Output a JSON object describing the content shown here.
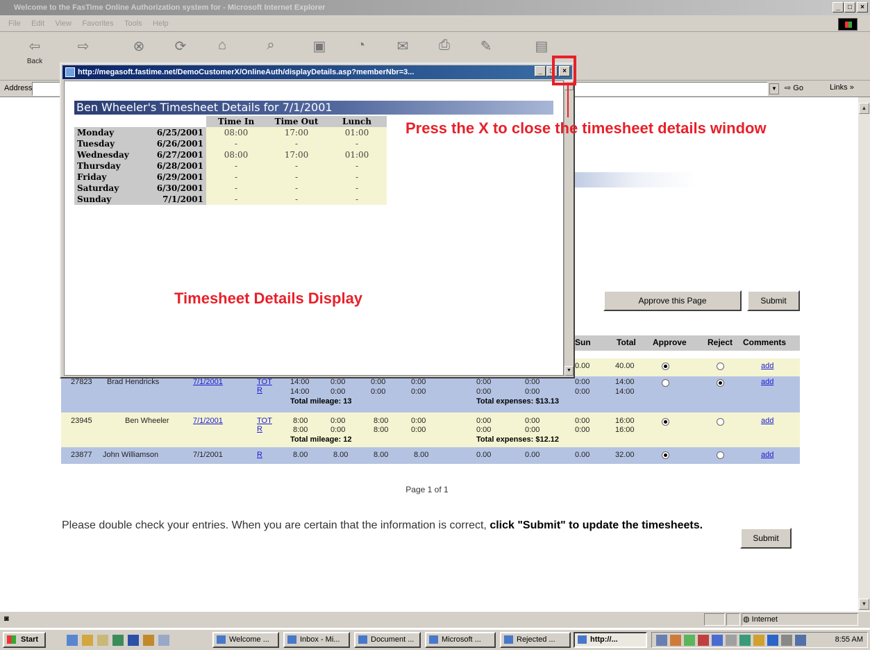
{
  "browser": {
    "title": "Welcome to the FasTime Online Authorization system for - Microsoft Internet Explorer",
    "menu": [
      "File",
      "Edit",
      "View",
      "Favorites",
      "Tools",
      "Help"
    ],
    "back_label": "Back",
    "address_label": "Address",
    "go_label": "Go",
    "links_label": "Links",
    "window_buttons": {
      "minimize": "_",
      "maximize": "□",
      "close": "×"
    }
  },
  "popup": {
    "title": "http://megasoft.fastime.net/DemoCustomerX/OnlineAuth/displayDetails.asp?memberNbr=3...",
    "close": "×",
    "header": "Ben Wheeler's Timesheet Details for 7/1/2001",
    "columns": [
      "Time In",
      "Time Out",
      "Lunch"
    ],
    "rows": [
      {
        "day": "Monday",
        "date": "6/25/2001",
        "in": "08:00",
        "out": "17:00",
        "lunch": "01:00"
      },
      {
        "day": "Tuesday",
        "date": "6/26/2001",
        "in": "-",
        "out": "-",
        "lunch": "-"
      },
      {
        "day": "Wednesday",
        "date": "6/27/2001",
        "in": "08:00",
        "out": "17:00",
        "lunch": "01:00"
      },
      {
        "day": "Thursday",
        "date": "6/28/2001",
        "in": "-",
        "out": "-",
        "lunch": "-"
      },
      {
        "day": "Friday",
        "date": "6/29/2001",
        "in": "-",
        "out": "-",
        "lunch": "-"
      },
      {
        "day": "Saturday",
        "date": "6/30/2001",
        "in": "-",
        "out": "-",
        "lunch": "-"
      },
      {
        "day": "Sunday",
        "date": "7/1/2001",
        "in": "-",
        "out": "-",
        "lunch": "-"
      }
    ]
  },
  "annotations": {
    "close_hint": "Press the X to close the timesheet details window",
    "details_label": "Timesheet Details Display",
    "color": "#e8202a"
  },
  "page": {
    "approve_button": "Approve this Page",
    "submit_button": "Submit",
    "grid_headers": [
      "Sun",
      "Total",
      "Approve",
      "Reject",
      "Comments"
    ],
    "row1": {
      "sun": "0.00",
      "total": "40.00",
      "comment": "add"
    },
    "row2": {
      "id": "27823",
      "name": "Brad Hendricks",
      "date": "7/1/2001",
      "t": "TOT",
      "r": "R",
      "line1": [
        "14:00",
        "0:00",
        "0:00",
        "0:00",
        "0:00",
        "0:00",
        "0:00",
        "14:00"
      ],
      "line2": [
        "14:00",
        "0:00",
        "0:00",
        "0:00",
        "0:00",
        "0:00",
        "0:00",
        "14:00"
      ],
      "mileage": "Total mileage: 13",
      "expenses": "Total expenses: $13.13",
      "comment": "add"
    },
    "row3": {
      "id": "23945",
      "name": "Ben Wheeler",
      "date": "7/1/2001",
      "t": "TOT",
      "r": "R",
      "line1": [
        "8:00",
        "0:00",
        "8:00",
        "0:00",
        "0:00",
        "0:00",
        "0:00",
        "16:00"
      ],
      "line2": [
        "8:00",
        "0:00",
        "8:00",
        "0:00",
        "0:00",
        "0:00",
        "0:00",
        "16:00"
      ],
      "mileage": "Total mileage: 12",
      "expenses": "Total expenses: $12.12",
      "comment": "add"
    },
    "row4": {
      "id": "23877",
      "name": "John Williamson",
      "date": "7/1/2001",
      "r": "R",
      "line1": [
        "8.00",
        "8.00",
        "8.00",
        "8.00",
        "0.00",
        "0.00",
        "0.00",
        "32.00"
      ],
      "comment": "add"
    },
    "pager": "Page 1 of 1",
    "notice_plain": "Please double check your entries. When you are certain that the information is correct, ",
    "notice_bold": "click \"Submit\" to update the timesheets."
  },
  "status": {
    "zone": "Internet"
  },
  "taskbar": {
    "start": "Start",
    "items": [
      "Welcome ...",
      "Inbox - Mi...",
      "Document ...",
      "Microsoft ...",
      "Rejected ...",
      "http://..."
    ],
    "clock": "8:55 AM"
  },
  "colors": {
    "row_yellow": "#f4f4d2",
    "row_blue": "#b5c3e3",
    "header_gray": "#c9c9c9"
  }
}
